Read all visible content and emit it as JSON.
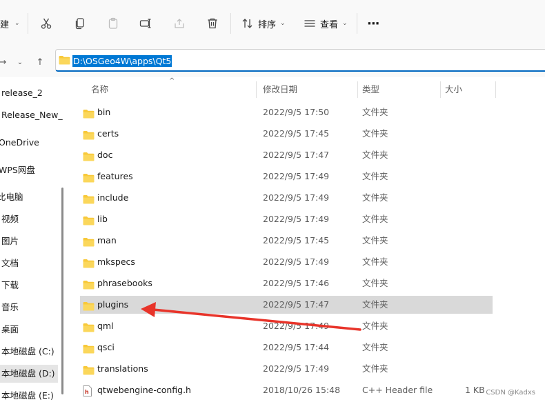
{
  "toolbar": {
    "new_label": "建",
    "sort_label": "排序",
    "view_label": "查看",
    "more_label": "···"
  },
  "address": {
    "path": "D:\\OSGeo4W\\apps\\Qt5"
  },
  "sidebar": {
    "items": [
      {
        "label": "release_2"
      },
      {
        "label": "Release_New_"
      },
      {
        "label": "OneDrive"
      },
      {
        "label": "WPS网盘"
      },
      {
        "label": "比电脑"
      },
      {
        "label": "视频"
      },
      {
        "label": "图片"
      },
      {
        "label": "文档"
      },
      {
        "label": "下载"
      },
      {
        "label": "音乐"
      },
      {
        "label": "桌面"
      },
      {
        "label": "本地磁盘 (C:)"
      },
      {
        "label": "本地磁盘 (D:)",
        "selected": true
      },
      {
        "label": "本地磁盘 (E:)"
      }
    ]
  },
  "columns": {
    "name": "名称",
    "date": "修改日期",
    "type": "类型",
    "size": "大小"
  },
  "files": [
    {
      "name": "bin",
      "date": "2022/9/5 17:50",
      "type": "文件夹",
      "size": "",
      "icon": "folder-icon"
    },
    {
      "name": "certs",
      "date": "2022/9/5 17:45",
      "type": "文件夹",
      "size": "",
      "icon": "folder-icon"
    },
    {
      "name": "doc",
      "date": "2022/9/5 17:47",
      "type": "文件夹",
      "size": "",
      "icon": "folder-icon"
    },
    {
      "name": "features",
      "date": "2022/9/5 17:49",
      "type": "文件夹",
      "size": "",
      "icon": "folder-icon"
    },
    {
      "name": "include",
      "date": "2022/9/5 17:49",
      "type": "文件夹",
      "size": "",
      "icon": "folder-icon"
    },
    {
      "name": "lib",
      "date": "2022/9/5 17:49",
      "type": "文件夹",
      "size": "",
      "icon": "folder-icon"
    },
    {
      "name": "man",
      "date": "2022/9/5 17:45",
      "type": "文件夹",
      "size": "",
      "icon": "folder-icon"
    },
    {
      "name": "mkspecs",
      "date": "2022/9/5 17:49",
      "type": "文件夹",
      "size": "",
      "icon": "folder-icon"
    },
    {
      "name": "phrasebooks",
      "date": "2022/9/5 17:46",
      "type": "文件夹",
      "size": "",
      "icon": "folder-icon"
    },
    {
      "name": "plugins",
      "date": "2022/9/5 17:47",
      "type": "文件夹",
      "size": "",
      "icon": "folder-icon",
      "highlighted": true
    },
    {
      "name": "qml",
      "date": "2022/9/5 17:49",
      "type": "文件夹",
      "size": "",
      "icon": "folder-icon"
    },
    {
      "name": "qsci",
      "date": "2022/9/5 17:44",
      "type": "文件夹",
      "size": "",
      "icon": "folder-icon"
    },
    {
      "name": "translations",
      "date": "2022/9/5 17:49",
      "type": "文件夹",
      "size": "",
      "icon": "folder-icon"
    },
    {
      "name": "qtwebengine-config.h",
      "date": "2018/10/26 15:48",
      "type": "C++ Header file",
      "size": "1 KB",
      "icon": "header-file-icon"
    }
  ],
  "watermark": "CSDN @Kadxs",
  "colors": {
    "accent": "#0078d4",
    "folder": "#f8c93a",
    "annotation_arrow": "#e8342a",
    "row_highlight": "#d9d9d9"
  }
}
